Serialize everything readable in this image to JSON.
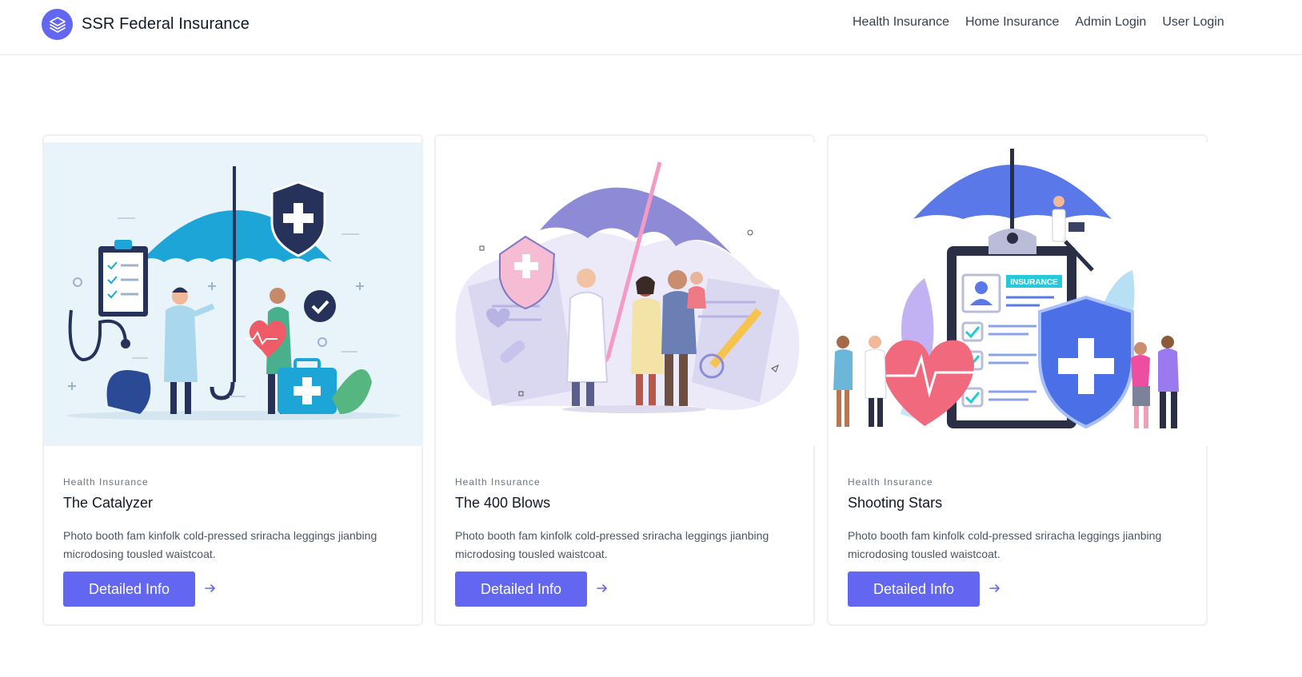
{
  "header": {
    "brand": "SSR Federal Insurance",
    "logo_icon": "stack-layers-icon",
    "nav": [
      "Health Insurance",
      "Home Insurance",
      "Admin Login",
      "User Login"
    ]
  },
  "cards": [
    {
      "category": "Health Insurance",
      "title": "The Catalyzer",
      "description": "Photo booth fam kinfolk cold-pressed sriracha leggings jianbing microdosing tousled waistcoat.",
      "button": "Detailed Info",
      "illustration": "health-umbrella-doctor-illustration"
    },
    {
      "category": "Health Insurance",
      "title": "The 400 Blows",
      "description": "Photo booth fam kinfolk cold-pressed sriracha leggings jianbing microdosing tousled waistcoat.",
      "button": "Detailed Info",
      "illustration": "family-umbrella-illustration"
    },
    {
      "category": "Health Insurance",
      "title": "Shooting Stars",
      "description": "Photo booth fam kinfolk cold-pressed sriracha leggings jianbing microdosing tousled waistcoat.",
      "button": "Detailed Info",
      "illustration": "clipboard-shield-illustration",
      "illustration_text": "INSURANCE"
    }
  ],
  "colors": {
    "accent": "#6366f1",
    "border": "#e5e7eb"
  }
}
